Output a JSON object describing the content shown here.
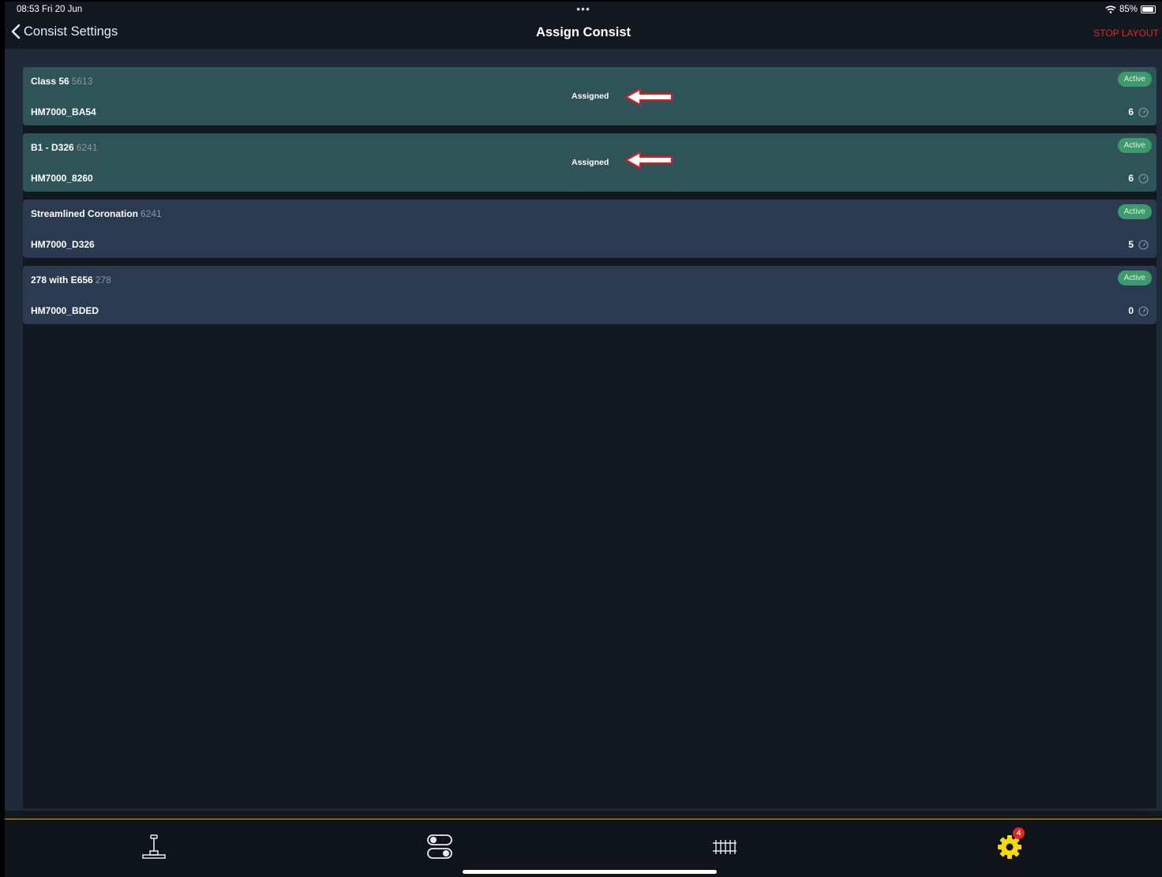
{
  "status": {
    "time": "08:53  Fri 20 Jun",
    "battery": "85%",
    "dots": "•••"
  },
  "nav": {
    "back_label": "Consist Settings",
    "title": "Assign Consist",
    "stop_label": "STOP LAYOUT"
  },
  "consists": [
    {
      "name": "Class 56",
      "number": "5613",
      "decoder": "HM7000_BA54",
      "status": "Active",
      "assigned": "Assigned",
      "count": "6"
    },
    {
      "name": "B1 - D326",
      "number": "6241",
      "decoder": "HM7000_8260",
      "status": "Active",
      "assigned": "Assigned",
      "count": "6"
    },
    {
      "name": "Streamlined Coronation",
      "number": "6241",
      "decoder": "HM7000_D326",
      "status": "Active",
      "count": "5"
    },
    {
      "name": "278 with E656",
      "number": "278",
      "decoder": "HM7000_BDED",
      "status": "Active",
      "count": "0"
    }
  ],
  "tabs": {
    "settings_badge": "4"
  },
  "colors": {
    "accent_yellow": "#f5d90a",
    "stop_red": "#e0262b",
    "active_green": "#3d9a6b",
    "assigned_card": "#2e5458",
    "card": "#2a3a50"
  }
}
